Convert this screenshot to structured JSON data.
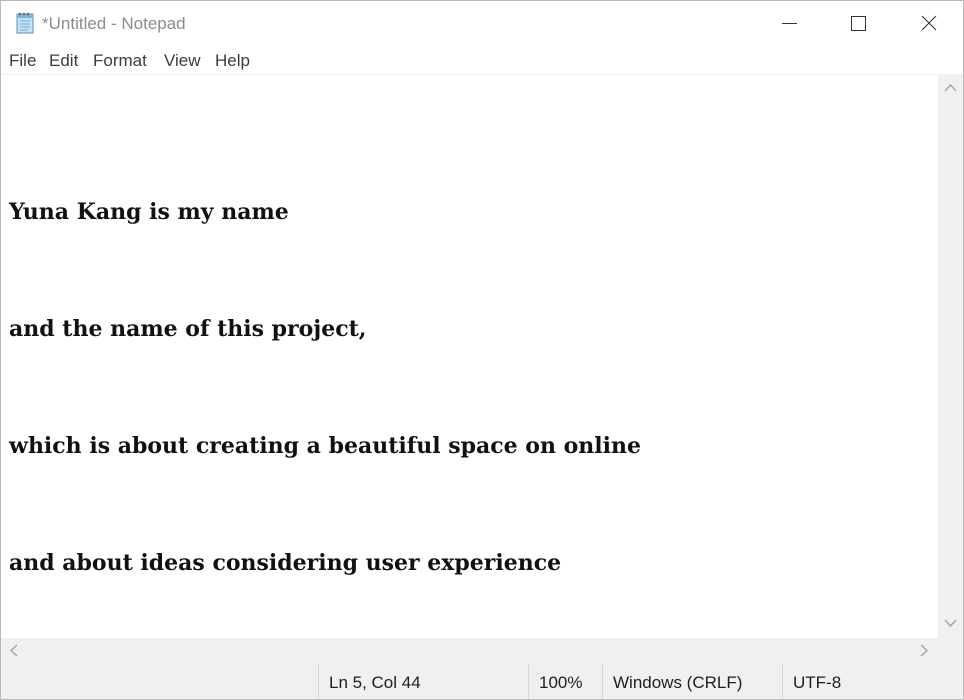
{
  "window": {
    "title": "*Untitled - Notepad",
    "icon": "notepad-icon"
  },
  "controls": {
    "minimize_icon": "minimize-icon",
    "maximize_icon": "maximize-icon",
    "close_icon": "close-icon"
  },
  "menu": {
    "items": [
      "File",
      "Edit",
      "Format",
      "View",
      "Help"
    ]
  },
  "editor": {
    "lines": [
      "Yuna Kang is my name",
      "and the name of this project,",
      "which is about creating a beautiful space on online",
      "and about ideas considering user experience"
    ]
  },
  "status": {
    "position": "Ln 5, Col 44",
    "zoom": "100%",
    "line_ending": "Windows (CRLF)",
    "encoding": "UTF-8"
  }
}
